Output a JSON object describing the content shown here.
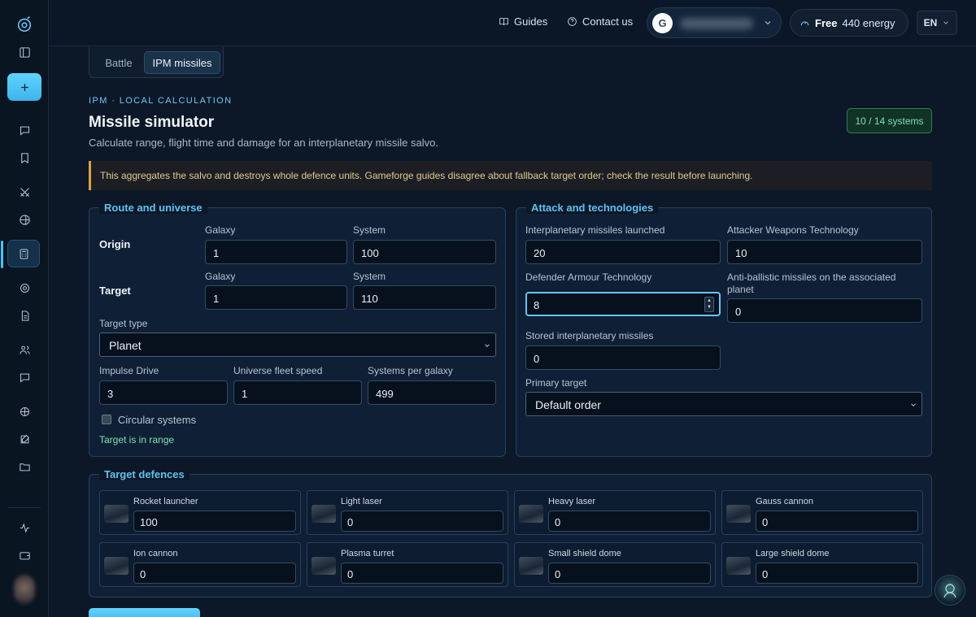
{
  "topbar": {
    "guides": "Guides",
    "contact": "Contact us",
    "account_initial": "G",
    "plan": "Free",
    "energy": "440 energy",
    "language": "EN"
  },
  "tabs": {
    "battle": "Battle",
    "ipm": "IPM missiles"
  },
  "header": {
    "eyebrow": "IPM · LOCAL CALCULATION",
    "title": "Missile simulator",
    "subtitle": "Calculate range, flight time and damage for an interplanetary missile salvo.",
    "systems_badge": "10 / 14 systems"
  },
  "warning": "This aggregates the salvo and destroys whole defence units. Gameforge guides disagree about fallback target order; check the result before launching.",
  "route": {
    "legend": "Route and universe",
    "origin_label": "Origin",
    "target_label": "Target",
    "galaxy_label": "Galaxy",
    "system_label": "System",
    "origin_galaxy": "1",
    "origin_system": "100",
    "target_galaxy": "1",
    "target_system": "110",
    "target_type_label": "Target type",
    "target_type": "Planet",
    "impulse_label": "Impulse Drive",
    "impulse": "3",
    "fleet_speed_label": "Universe fleet speed",
    "fleet_speed": "1",
    "systems_per_galaxy_label": "Systems per galaxy",
    "systems_per_galaxy": "499",
    "circular_label": "Circular systems",
    "status": "Target is in range"
  },
  "attack": {
    "legend": "Attack and technologies",
    "ipm_launched_label": "Interplanetary missiles launched",
    "ipm_launched": "20",
    "weapons_label": "Attacker Weapons Technology",
    "weapons": "10",
    "armour_label": "Defender Armour Technology",
    "armour": "8",
    "abm_label_1": "Anti-ballistic missiles on the associated",
    "abm_label_2": "planet",
    "abm": "0",
    "stored_label": "Stored interplanetary missiles",
    "stored": "0",
    "primary_label": "Primary target",
    "primary": "Default order"
  },
  "defences": {
    "legend": "Target defences",
    "items": [
      {
        "name": "Rocket launcher",
        "value": "100"
      },
      {
        "name": "Light laser",
        "value": "0"
      },
      {
        "name": "Heavy laser",
        "value": "0"
      },
      {
        "name": "Gauss cannon",
        "value": "0"
      },
      {
        "name": "Ion cannon",
        "value": "0"
      },
      {
        "name": "Plasma turret",
        "value": "0"
      },
      {
        "name": "Small shield dome",
        "value": "0"
      },
      {
        "name": "Large shield dome",
        "value": "0"
      }
    ]
  }
}
